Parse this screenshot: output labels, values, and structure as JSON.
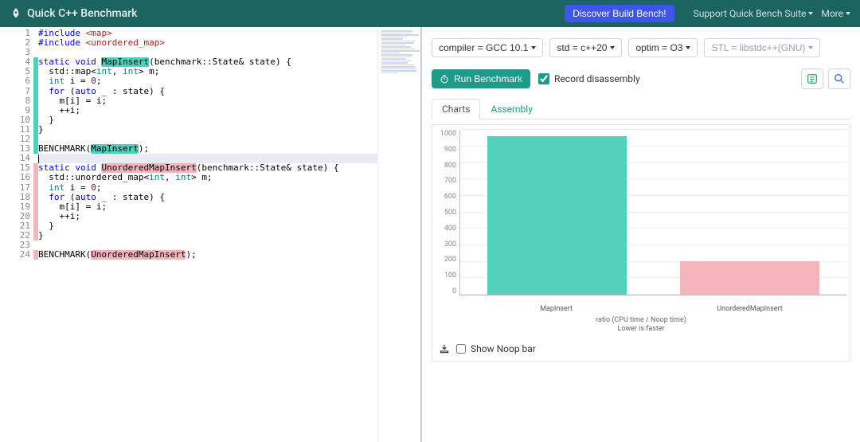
{
  "nav": {
    "brand": "Quick C++ Benchmark",
    "discover": "Discover Build Bench!",
    "support": "Support Quick Bench Suite",
    "more": "More"
  },
  "options": {
    "compiler": "compiler = GCC 10.1",
    "std": "std = c++20",
    "optim": "optim = O3",
    "stl": "STL = libstdc++(GNU)"
  },
  "run": {
    "button": "Run Benchmark",
    "record": "Record disassembly"
  },
  "tabs": {
    "charts": "Charts",
    "assembly": "Assembly"
  },
  "chart_data": {
    "type": "bar",
    "categories": [
      "MapInsert",
      "UnorderedMapInsert"
    ],
    "values": [
      960,
      205
    ],
    "title": "",
    "xlabel": "",
    "ylabel": "",
    "ylim": [
      0,
      1000
    ],
    "ticks": [
      0,
      100,
      200,
      300,
      400,
      500,
      600,
      700,
      800,
      900,
      1000
    ],
    "colors": [
      "#54d1bc",
      "#f3b4bb"
    ],
    "caption_l1": "ratio (CPU time / Noop time)",
    "caption_l2": "Lower is faster"
  },
  "noop": {
    "label": "Show Noop bar"
  },
  "code": {
    "lines": [
      {
        "n": 1,
        "hl": "",
        "segs": [
          {
            "t": "#include ",
            "c": "kw"
          },
          {
            "t": "<map>",
            "c": "lib"
          }
        ]
      },
      {
        "n": 2,
        "hl": "",
        "segs": [
          {
            "t": "#include ",
            "c": "kw"
          },
          {
            "t": "<unordered_map>",
            "c": "lib"
          }
        ]
      },
      {
        "n": 3,
        "hl": "",
        "segs": [
          {
            "t": " "
          }
        ]
      },
      {
        "n": 4,
        "hl": "t",
        "segs": [
          {
            "t": "static void ",
            "c": "kw"
          },
          {
            "t": "MapInsert",
            "c": "hl-t"
          },
          {
            "t": "(benchmark::State& state) {"
          }
        ]
      },
      {
        "n": 5,
        "hl": "t",
        "segs": [
          {
            "t": "  std::map<"
          },
          {
            "t": "int",
            "c": "type"
          },
          {
            "t": ", "
          },
          {
            "t": "int",
            "c": "type"
          },
          {
            "t": "> m;"
          }
        ]
      },
      {
        "n": 6,
        "hl": "t",
        "segs": [
          {
            "t": "  "
          },
          {
            "t": "int",
            "c": "type"
          },
          {
            "t": " i = "
          },
          {
            "t": "0",
            "c": "num"
          },
          {
            "t": ";"
          }
        ]
      },
      {
        "n": 7,
        "hl": "t",
        "segs": [
          {
            "t": "  "
          },
          {
            "t": "for",
            "c": "kw"
          },
          {
            "t": " ("
          },
          {
            "t": "auto",
            "c": "kw"
          },
          {
            "t": " _ : state) {"
          }
        ]
      },
      {
        "n": 8,
        "hl": "t",
        "segs": [
          {
            "t": "    m[i] = i;"
          }
        ]
      },
      {
        "n": 9,
        "hl": "t",
        "segs": [
          {
            "t": "    ++i;"
          }
        ]
      },
      {
        "n": 10,
        "hl": "t",
        "segs": [
          {
            "t": "  }"
          }
        ]
      },
      {
        "n": 11,
        "hl": "t",
        "segs": [
          {
            "t": "}"
          }
        ]
      },
      {
        "n": 12,
        "hl": "t",
        "segs": [
          {
            "t": " "
          }
        ]
      },
      {
        "n": 13,
        "hl": "t",
        "segs": [
          {
            "t": "BENCHMARK("
          },
          {
            "t": "MapInsert",
            "c": "hl-t"
          },
          {
            "t": ");"
          }
        ]
      },
      {
        "n": 14,
        "hl": "",
        "cur": true,
        "segs": [
          {
            "t": ""
          }
        ]
      },
      {
        "n": 15,
        "hl": "p",
        "segs": [
          {
            "t": "static void ",
            "c": "kw"
          },
          {
            "t": "UnorderedMapInsert",
            "c": "hl-p"
          },
          {
            "t": "(benchmark::State& state) {"
          }
        ]
      },
      {
        "n": 16,
        "hl": "p",
        "segs": [
          {
            "t": "  std::unordered_map<"
          },
          {
            "t": "int",
            "c": "type"
          },
          {
            "t": ", "
          },
          {
            "t": "int",
            "c": "type"
          },
          {
            "t": "> m;"
          }
        ]
      },
      {
        "n": 17,
        "hl": "p",
        "segs": [
          {
            "t": "  "
          },
          {
            "t": "int",
            "c": "type"
          },
          {
            "t": " i = "
          },
          {
            "t": "0",
            "c": "num"
          },
          {
            "t": ";"
          }
        ]
      },
      {
        "n": 18,
        "hl": "p",
        "segs": [
          {
            "t": "  "
          },
          {
            "t": "for",
            "c": "kw"
          },
          {
            "t": " ("
          },
          {
            "t": "auto",
            "c": "kw"
          },
          {
            "t": " _ : state) {"
          }
        ]
      },
      {
        "n": 19,
        "hl": "p",
        "segs": [
          {
            "t": "    m[i] = i;"
          }
        ]
      },
      {
        "n": 20,
        "hl": "p",
        "segs": [
          {
            "t": "    ++i;"
          }
        ]
      },
      {
        "n": 21,
        "hl": "p",
        "segs": [
          {
            "t": "  }"
          }
        ]
      },
      {
        "n": 22,
        "hl": "p",
        "segs": [
          {
            "t": "}"
          }
        ]
      },
      {
        "n": 23,
        "hl": "",
        "segs": [
          {
            "t": " "
          }
        ]
      },
      {
        "n": 24,
        "hl": "p",
        "segs": [
          {
            "t": "BENCHMARK("
          },
          {
            "t": "UnorderedMapInsert",
            "c": "hl-p"
          },
          {
            "t": ");"
          }
        ]
      }
    ]
  }
}
